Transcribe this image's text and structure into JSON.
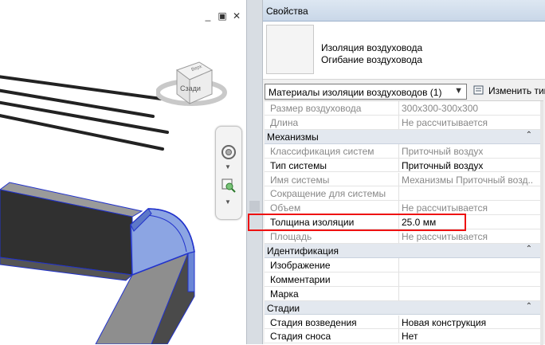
{
  "view_controls": {
    "minimize": "_",
    "restore": "▣",
    "close": "✕"
  },
  "viewcube": {
    "face_label": "Сзади",
    "top_label": "Верх"
  },
  "properties": {
    "title": "Свойства",
    "type_selector": {
      "family": "Изоляция воздуховода",
      "type": "Огибание воздуховода"
    },
    "filter": {
      "value": "Материалы изоляции воздуховодов (1)"
    },
    "edit_type_label": "Изменить тип",
    "rows": [
      {
        "kind": "param",
        "name": "Размер воздуховода",
        "value": "300x300-300x300",
        "disabled": true
      },
      {
        "kind": "param",
        "name": "Длина",
        "value": "Не рассчитывается",
        "disabled": true
      },
      {
        "kind": "group",
        "name": "Механизмы",
        "collapse": "⌃"
      },
      {
        "kind": "param",
        "name": "Классификация систем",
        "value": "Приточный воздух",
        "disabled": true
      },
      {
        "kind": "param",
        "name": "Тип системы",
        "value": "Приточный воздух",
        "disabled": false
      },
      {
        "kind": "param",
        "name": "Имя системы",
        "value": "Механизмы Приточный возд...",
        "disabled": true
      },
      {
        "kind": "param",
        "name": "Сокращение для системы",
        "value": "",
        "disabled": true
      },
      {
        "kind": "param",
        "name": "Объем",
        "value": "Не рассчитывается",
        "disabled": true
      },
      {
        "kind": "param",
        "name": "Толщина изоляции",
        "value": "25.0 мм",
        "disabled": false
      },
      {
        "kind": "param",
        "name": "Площадь",
        "value": "Не рассчитывается",
        "disabled": true
      },
      {
        "kind": "group",
        "name": "Идентификация",
        "collapse": "⌃"
      },
      {
        "kind": "param",
        "name": "Изображение",
        "value": "",
        "disabled": false
      },
      {
        "kind": "param",
        "name": "Комментарии",
        "value": "",
        "disabled": false
      },
      {
        "kind": "param",
        "name": "Марка",
        "value": "",
        "disabled": false
      },
      {
        "kind": "group",
        "name": "Стадии",
        "collapse": "⌃"
      },
      {
        "kind": "param",
        "name": "Стадия возведения",
        "value": "Новая конструкция",
        "disabled": false
      },
      {
        "kind": "param",
        "name": "Стадия сноса",
        "value": "Нет",
        "disabled": false
      }
    ]
  },
  "colors": {
    "highlight": "#e11111",
    "insulation": "#7f9be0",
    "duct_top": "#8c8c8c",
    "duct_side": "#3b3b3b",
    "edge": "#2233cc"
  }
}
